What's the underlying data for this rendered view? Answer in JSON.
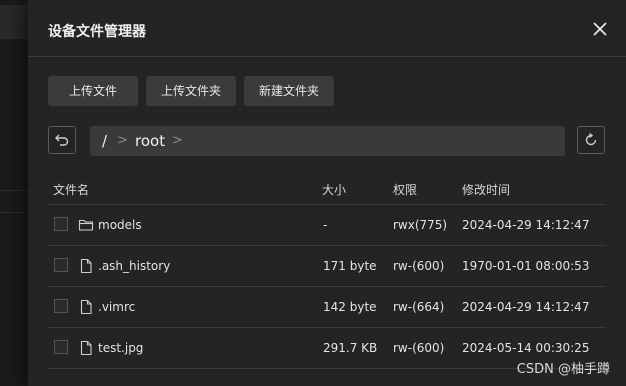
{
  "dialog": {
    "title": "设备文件管理器"
  },
  "toolbar": {
    "upload_file": "上传文件",
    "upload_folder": "上传文件夹",
    "new_folder": "新建文件夹"
  },
  "path": {
    "root_segment": "/",
    "segment_1": "root",
    "separator": ">"
  },
  "table": {
    "headers": {
      "name": "文件名",
      "size": "大小",
      "permission": "权限",
      "modified": "修改时间"
    },
    "rows": [
      {
        "icon": "folder-icon",
        "name": "models",
        "size": "-",
        "permission": "rwx(775)",
        "modified": "2024-04-29 14:12:47"
      },
      {
        "icon": "file-icon",
        "name": ".ash_history",
        "size": "171 byte",
        "permission": "rw-(600)",
        "modified": "1970-01-01 08:00:53"
      },
      {
        "icon": "file-icon",
        "name": ".vimrc",
        "size": "142 byte",
        "permission": "rw-(664)",
        "modified": "2024-04-29 14:12:47"
      },
      {
        "icon": "file-icon",
        "name": "test.jpg",
        "size": "291.7 KB",
        "permission": "rw-(600)",
        "modified": "2024-05-14 00:30:25"
      }
    ]
  },
  "watermark": "CSDN @柚手蹲",
  "colors": {
    "panel_bg": "#242424",
    "button_bg": "#3b3b3b",
    "path_bg": "#3a3a3a",
    "text": "#e6e6e6"
  }
}
